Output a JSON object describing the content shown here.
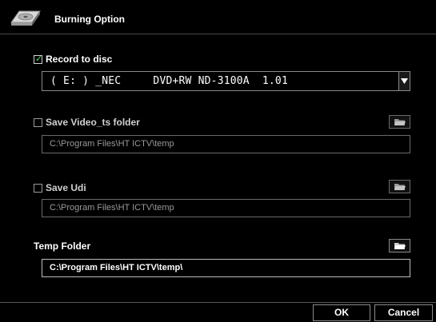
{
  "window": {
    "title": "Burning Option",
    "icon": "disc-drive-icon"
  },
  "record": {
    "label": "Record to disc",
    "checked": true,
    "drive": "( E: ) _NEC     DVD+RW ND-3100A  1.01"
  },
  "video_ts": {
    "label": "Save Video_ts folder",
    "checked": false,
    "path": "C:\\Program Files\\HT ICTV\\temp"
  },
  "udi": {
    "label": "Save Udi",
    "checked": false,
    "path": "C:\\Program Files\\HT ICTV\\temp"
  },
  "temp": {
    "label": "Temp Folder",
    "path": "C:\\Program Files\\HT ICTV\\temp\\"
  },
  "buttons": {
    "ok": "OK",
    "cancel": "Cancel"
  },
  "colors": {
    "background": "#000000",
    "check_tick": "#5fd35f",
    "dim_text": "#9a9a9a"
  }
}
